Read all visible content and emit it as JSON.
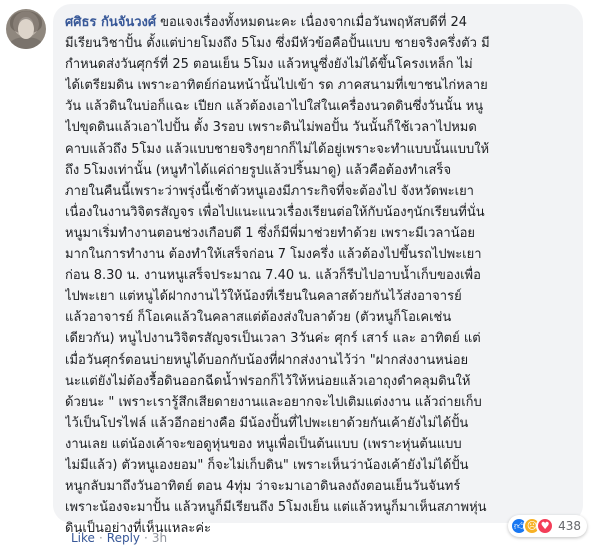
{
  "comment": {
    "author": "ศศิธร กันจันวงศ์",
    "lines": [
      "ขอแจงเรื่องทั้งหมดนะคะ เนื่องจากเมื่อวันพฤหัสบดีที่ 24",
      "มีเรียนวิชาปั้น ตั้งแต่บ่ายโมงถึง 5โมง ซึ่งมีหัวข้อคือปั้นแบบ ชายจริงครึ่งตัว มี",
      "กำหนดส่งวันศุกร์ที่ 25 ตอนเย็น 5โมง แล้วหนูซึ่งยังไม่ได้ขึ้นโครงเหล็ก ไม่",
      "ได้เตรียมดิน เพราะอาทิตย์ก่อนหน้านั้นไปเข้า รด ภาคสนามที่เขาชนไก่หลาย",
      "วัน แล้วดินในบ่อก็แฉะ เปียก แล้วต้องเอาไปใส่ในเครื่องนวดดินซึ่งวันนั้น หนู",
      "ไปขุดดินแล้วเอาไปปั้น ตั้ง 3รอบ เพราะดินไม่พอปั้น วันนั้นก็ใช้เวลาไปหมด",
      "คาบแล้วถึง 5โมง แล้วแบบชายจริงๆยากก็ไม่ได้อยู่เพราะจะทำแบบนั้นแบบให้",
      "ถึง 5โมงเท่านั้น (หนูทำได้แค่ถ่ายรูปแล้วปริ้นมาดู) แล้วคือต้องทำเสร็จ",
      "ภายในคืนนี้เพราะว่าพรุ่งนี้เช้าตัวหนูเองมีภาระกิจที่จะต้องไป จังหวัดพะเยา",
      "เนื่องในงานวิจิตรสัญจร เพื่อไปแนะแนวเรื่องเรียนต่อให้กับน้องๆนักเรียนที่นั่น",
      "หนูมาเริ่มทำงานตอนช่วงเกือบดึ 1 ซึ่งก็มีพี่มาช่วยทำด้วย เพราะมีเวลาน้อย",
      "มากในการทำงาน ต้องทำให้เสร็จก่อน 7 โมงครึ่ง แล้วต้องไปขึ้นรถไปพะเยา",
      "ก่อน 8.30 น. งานหนูเสร็จประมาณ 7.40 น. แล้วก็รีบไปอาบน้ำเก็บของเพื่อ",
      "ไปพะเยา แต่หนูได้ฝากงานไว้ให้น้องที่เรียนในคลาสด้วยกันไว้ส่งอาจารย์",
      "แล้วอาจารย์ ก็โอเคแล้วในคลาสแต่ต้องส่งใบลาด้วย (ตัวหนูก็โอเคเช่น",
      "เดียวกัน) หนูไปงานวิจิตรสัญจรเป็นเวลา 3วันค่ะ ศุกร์ เสาร์ และ อาทิตย์ แต่",
      "เมื่อวันศุกร์ตอนบ่ายหนูได้บอกกับน้องที่ฝากส่งงานไว้ว่า \"ฝากส่งงานหน่อย",
      "นะแต่ยังไม่ต้องรื้อดินออกฉีดน้ำฟรอกก็ไว้ให้หน่อยแล้วเอาถุงดำคลุมดินให้",
      "ด้วยนะ \" เพราะเรารู้สึกเสียดายงานและอยากจะไปเติมแต่งงาน แล้วถ่ายเก็บ",
      "ไว้เป็นโปรไฟล์ แล้วอีกอย่างคือ มีน้องปั้นที่ไปพะเยาด้วยกันเค้ายังไม่ได้ปั้น",
      "งานเลย แต่น้องเค้าจะขอดูหุ่นของ หนูเพื่อเป็นต้นแบบ (เพราะหุ่นต้นแบบ",
      "ไม่มีแล้ว) ตัวหนูเองยอม\" ก็จะไม่เก็บดิน\" เพราะเห็นว่าน้องเค้ายังไม่ได้ปั้น",
      "หนูกลับมาถึงวันอาทิตย์ ตอน 4ทุ่ม ว่าจะมาเอาดินลงถังตอนเย็นวันจันทร์",
      "เพราะน้องจะมาปั้น แล้วหนูก็มีเรียนถึง 5โมงเย็น แต่แล้วหนูก็มาเห็นสภาพหุ่น",
      "ดินเป็นอย่างที่เห็นแหละค่ะ"
    ]
  },
  "reactions": {
    "count": "438",
    "icons": [
      "like-reaction",
      "sad-reaction",
      "love-reaction"
    ]
  },
  "actions": {
    "like": "Like",
    "separator": "·",
    "reply": "Reply",
    "time": "3h"
  },
  "colors": {
    "link": "#385898",
    "bubble": "#f2f3f5",
    "text": "#1c1e21",
    "like": "#1877f2",
    "sad": "#f7b125",
    "love": "#f33e58"
  }
}
